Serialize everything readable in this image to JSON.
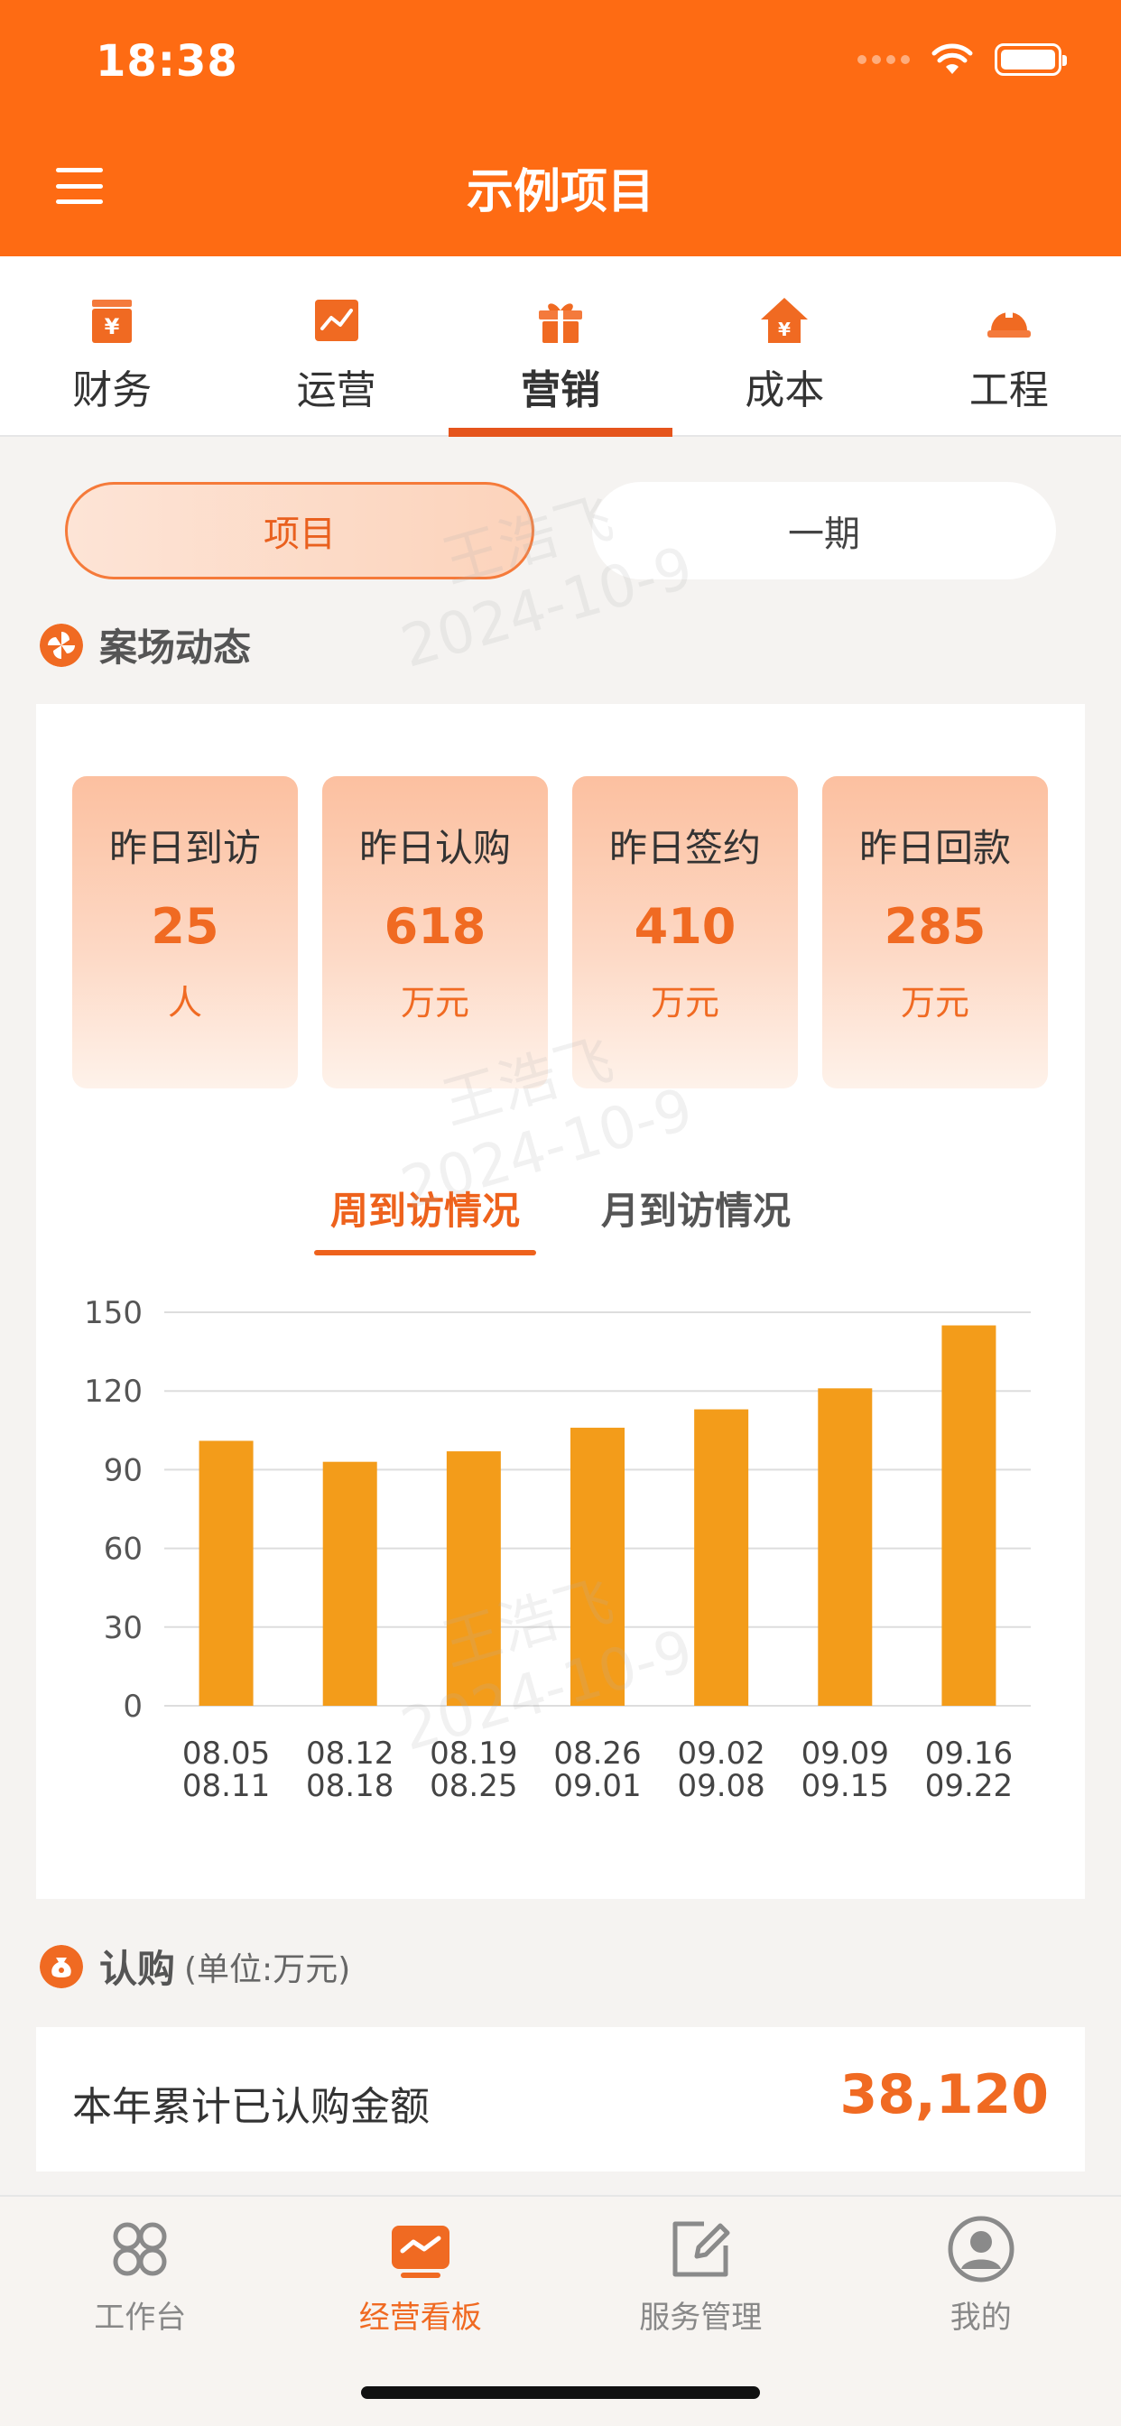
{
  "status_bar": {
    "time": "18:38"
  },
  "header": {
    "title": "示例项目"
  },
  "category_tabs": [
    {
      "label": "财务",
      "icon": "finance-icon"
    },
    {
      "label": "运营",
      "icon": "operations-icon"
    },
    {
      "label": "营销",
      "icon": "marketing-gift-icon",
      "active": true
    },
    {
      "label": "成本",
      "icon": "cost-house-icon"
    },
    {
      "label": "工程",
      "icon": "engineering-helmet-icon"
    }
  ],
  "segment": {
    "left": "项目",
    "right": "一期"
  },
  "watermark": {
    "name": "王浩飞",
    "date": "2024-10-9"
  },
  "sales_section": {
    "title": "案场动态",
    "stats": [
      {
        "label": "昨日到访",
        "value": "25",
        "unit": "人"
      },
      {
        "label": "昨日认购",
        "value": "618",
        "unit": "万元"
      },
      {
        "label": "昨日签约",
        "value": "410",
        "unit": "万元"
      },
      {
        "label": "昨日回款",
        "value": "285",
        "unit": "万元"
      }
    ],
    "chart_tabs": [
      "周到访情况",
      "月到访情况"
    ]
  },
  "chart_data": {
    "type": "bar",
    "categories": [
      [
        "08.05",
        "08.11"
      ],
      [
        "08.12",
        "08.18"
      ],
      [
        "08.19",
        "08.25"
      ],
      [
        "08.26",
        "09.01"
      ],
      [
        "09.02",
        "09.08"
      ],
      [
        "09.09",
        "09.15"
      ],
      [
        "09.16",
        "09.22"
      ]
    ],
    "values": [
      101,
      93,
      97,
      106,
      113,
      121,
      145
    ],
    "yticks": [
      0,
      30,
      60,
      90,
      120,
      150
    ],
    "ylim": [
      0,
      150
    ],
    "grid": true,
    "bar_color": "#f39c1a"
  },
  "subscription_section": {
    "title": "认购",
    "unit": "(单位:万元)",
    "label": "本年累计已认购金额",
    "value": "38,120"
  },
  "bottom_nav": [
    {
      "label": "工作台",
      "icon": "workbench-icon"
    },
    {
      "label": "经营看板",
      "icon": "dashboard-icon",
      "active": true
    },
    {
      "label": "服务管理",
      "icon": "edit-icon"
    },
    {
      "label": "我的",
      "icon": "profile-icon"
    }
  ],
  "colors": {
    "brand": "#fe6b13",
    "accent": "#f06a22",
    "bar": "#f39c1a"
  }
}
